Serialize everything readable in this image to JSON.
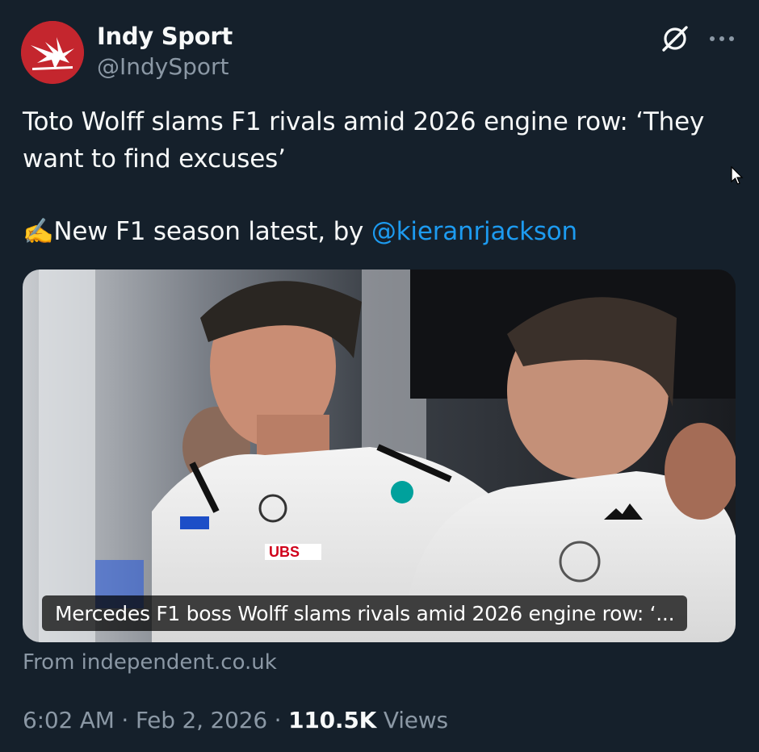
{
  "author": {
    "display_name": "Indy Sport",
    "handle": "@IndySport",
    "avatar_icon": "eagle-logo-icon",
    "avatar_color": "#c4262e"
  },
  "header_actions": {
    "grok_icon": "grok-slash-icon",
    "more_icon": "more-dots-icon"
  },
  "tweet": {
    "text": "Toto Wolff slams F1 rivals amid 2026 engine row: ‘They want to find excuses’",
    "line2_emoji": "✍️",
    "line2_prefix": "New F1 season latest, by ",
    "mention": "@kieranrjackson"
  },
  "card": {
    "caption": "Mercedes F1 boss Wolff slams rivals amid 2026 engine row: ‘...",
    "source": "From independent.co.uk"
  },
  "meta": {
    "time": "6:02 AM",
    "separator": " · ",
    "date": "Feb 2, 2026",
    "views_count": "110.5K",
    "views_label": " Views"
  },
  "colors": {
    "background": "#15202b",
    "text_primary": "#f7f9f9",
    "text_secondary": "#8b98a5",
    "link": "#1d9bf0"
  }
}
